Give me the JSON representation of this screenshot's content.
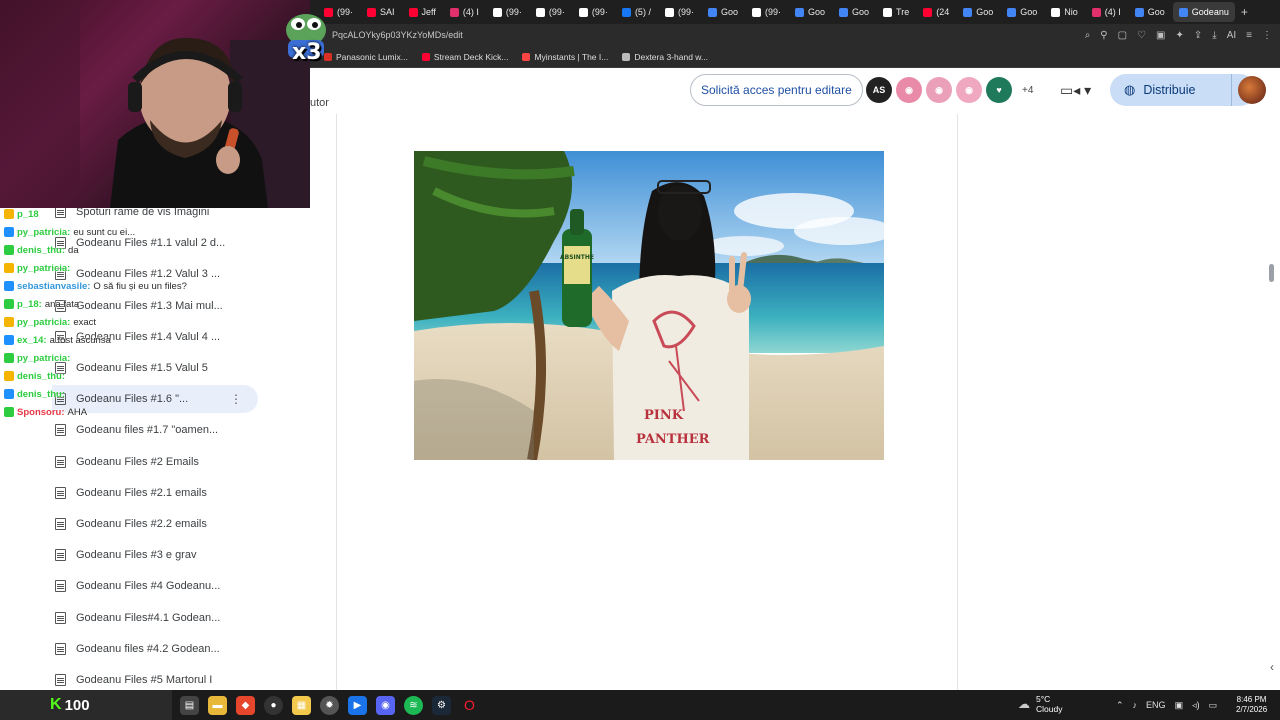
{
  "browser": {
    "tabs": [
      {
        "label": "(99·",
        "icon_color": "#ff0033"
      },
      {
        "label": "SAI",
        "icon_color": "#ff0033"
      },
      {
        "label": "Jeff",
        "icon_color": "#ff0033"
      },
      {
        "label": "(4) I",
        "icon_color": "#e1306c"
      },
      {
        "label": "(99·",
        "icon_color": "#ffffff"
      },
      {
        "label": "(99·",
        "icon_color": "#ffffff"
      },
      {
        "label": "(99·",
        "icon_color": "#ffffff"
      },
      {
        "label": "(5) /",
        "icon_color": "#1877f2"
      },
      {
        "label": "(99·",
        "icon_color": "#ffffff"
      },
      {
        "label": "Goo",
        "icon_color": "#4285f4"
      },
      {
        "label": "(99·",
        "icon_color": "#ffffff"
      },
      {
        "label": "Goo",
        "icon_color": "#4285f4"
      },
      {
        "label": "Goo",
        "icon_color": "#4285f4"
      },
      {
        "label": "Tre",
        "icon_color": "#ffffff"
      },
      {
        "label": "(24",
        "icon_color": "#ff0033"
      },
      {
        "label": "Goo",
        "icon_color": "#4285f4"
      },
      {
        "label": "Goo",
        "icon_color": "#4285f4"
      },
      {
        "label": "Nio",
        "icon_color": "#ffffff"
      },
      {
        "label": "(4) I",
        "icon_color": "#e1306c"
      },
      {
        "label": "Goo",
        "icon_color": "#4285f4"
      },
      {
        "label": "Godeanu",
        "icon_color": "#4285f4"
      }
    ],
    "url": "PqcALOYky6p03YKzYoMDs/edit",
    "bookmarks": [
      {
        "label": "Panasonic Lumix...",
        "icon_color": "#d93025"
      },
      {
        "label": "Stream Deck Kick...",
        "icon_color": "#ff0033"
      },
      {
        "label": "Myinstants | The I...",
        "icon_color": "#ff4444"
      },
      {
        "label": "Dextera 3-hand w...",
        "icon_color": "#bbbbbb"
      }
    ]
  },
  "docs": {
    "header_fragment": "utor",
    "request_edit_label": "Solicită acces pentru editare",
    "extra_viewers": "+4",
    "share_label": "Distribuie",
    "avatar_colors": [
      "#222222",
      "#e88aa8",
      "#e9a0b8",
      "#f0a8c0",
      "#1e7a5a"
    ]
  },
  "outline": {
    "items": [
      {
        "label": "Spoturi rame de vis Imagini",
        "selected": false
      },
      {
        "label": "Godeanu Files #1.1 valul 2 d...",
        "selected": false
      },
      {
        "label": "Godeanu Files #1.2 Valul 3 ...",
        "selected": false
      },
      {
        "label": "Godeanu Files #1.3 Mai mul...",
        "selected": false
      },
      {
        "label": "Godeanu Files #1.4 Valul 4 ...",
        "selected": false
      },
      {
        "label": "Godeanu Files #1.5 Valul 5",
        "selected": false
      },
      {
        "label": "Godeanu Files #1.6 \"...",
        "selected": true
      },
      {
        "label": "Godeanu files #1.7 \"oamen...",
        "selected": false
      },
      {
        "label": "Godeanu Files #2 Emails",
        "selected": false
      },
      {
        "label": "Godeanu Files #2.1 emails",
        "selected": false
      },
      {
        "label": "Godeanu Files #2.2 emails",
        "selected": false
      },
      {
        "label": "Godeanu Files #3 e grav",
        "selected": false
      },
      {
        "label": "Godeanu Files #4 Godeanu...",
        "selected": false
      },
      {
        "label": "Godeanu Files#4.1 Godean...",
        "selected": false
      },
      {
        "label": "Godeanu files #4.2 Godean...",
        "selected": false
      },
      {
        "label": "Godeanu Files #5 Martorul I",
        "selected": false
      }
    ]
  },
  "image": {
    "bottle_label": "ABSINTHE",
    "shirt_text_1": "PINK",
    "shirt_text_2": "PANTHER"
  },
  "stream": {
    "emote_multiplier": "x3",
    "chat": [
      {
        "user": "p_18",
        "message": "",
        "color": "#2ecc40"
      },
      {
        "user": "py_patricia:",
        "message": "eu sunt cu ei...",
        "color": "#2ecc40"
      },
      {
        "user": "denis_thu:",
        "message": "da",
        "color": "#2ecc40"
      },
      {
        "user": "py_patricia:",
        "message": "",
        "color": "#2ecc40"
      },
      {
        "user": "sebastianvasile:",
        "message": "O să fiu și eu un files?",
        "color": "#3498db"
      },
      {
        "user": "p_18:",
        "message": "ana fata",
        "color": "#2ecc40"
      },
      {
        "user": "py_patricia:",
        "message": "exact",
        "color": "#2ecc40"
      },
      {
        "user": "ex_14:",
        "message": "a fost ascunsa",
        "color": "#2ecc40"
      },
      {
        "user": "py_patricia:",
        "message": "",
        "color": "#2ecc40"
      },
      {
        "user": "denis_thu:",
        "message": "",
        "color": "#2ecc40"
      },
      {
        "user": "denis_thu:",
        "message": "",
        "color": "#2ecc40"
      },
      {
        "user": "Sponsoru:",
        "message": "AHA",
        "color": "#e63946"
      }
    ],
    "viewer_count": "100"
  },
  "taskbar": {
    "weather_temp": "5°C",
    "weather_desc": "Cloudy",
    "language": "ENG",
    "time": "8:46 PM",
    "date": "2/7/2026",
    "notification_count": "1"
  }
}
